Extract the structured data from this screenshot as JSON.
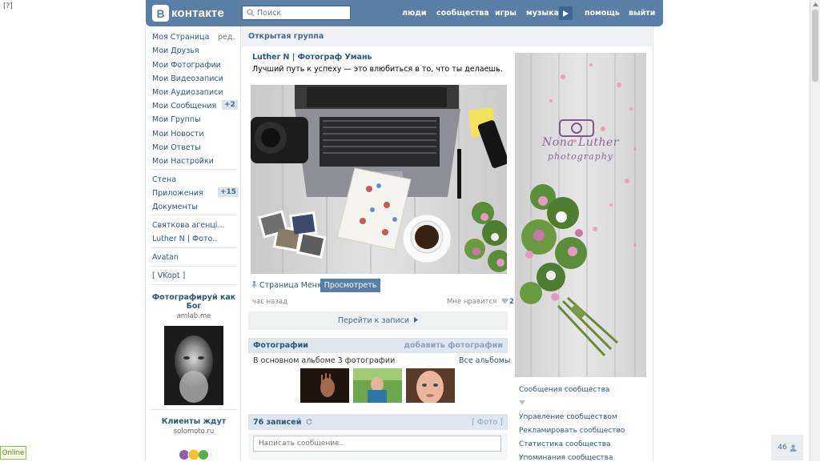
{
  "corner_mark": "[?]",
  "header": {
    "logo_text": "контакте",
    "logo_letter": "В",
    "search_placeholder": "Поиск",
    "nav": [
      "люди",
      "сообщества",
      "игры",
      "музыка",
      "помощь",
      "выйти"
    ]
  },
  "left_menu": {
    "items": [
      "Моя Страница",
      "Мои Друзья",
      "Мои Фотографии",
      "Мои Видеозаписи",
      "Мои Аудиозаписи",
      "Мои Сообщения",
      "Мои Группы",
      "Мои Новости",
      "Мои Ответы",
      "Мои Настройки"
    ],
    "edit_label": "ред.",
    "messages_badge": "+2",
    "group2": [
      "Стена",
      "Приложения",
      "Документы"
    ],
    "apps_badge": "+15",
    "group3": [
      "Святкова агенці...",
      "Luther N | Фото.."
    ],
    "group4": [
      "Avatan"
    ],
    "group5": [
      "[ VKopt ]"
    ]
  },
  "ads": [
    {
      "title": "Фотографируй как Бог",
      "site": "amlab.me"
    },
    {
      "title": "Клиенты ждут",
      "site": "solomoto.ru"
    }
  ],
  "main": {
    "group_type": "Открытая группа",
    "post": {
      "author": "Luther N | Фотограф Умань",
      "text": "Лучший путь к успеху — это влюбиться в то, что ты делаешь.",
      "link_label": "Страница Меню",
      "view_button": "Просмотреть",
      "time": "час назад",
      "like_label": "Мне нравится",
      "like_count": "2"
    },
    "goto_posts": "Перейти к записи",
    "photos": {
      "title": "Фотографии",
      "add_label": "добавить фотографии",
      "album_info": "В основном альбоме 3 фотографии",
      "all_albums": "Все альбомы"
    },
    "wall": {
      "count_label": "76 записей",
      "photo_filter": "[ Фото ]",
      "message_placeholder": "Написать сообщение.."
    }
  },
  "right": {
    "cover_name": "Nona Luther",
    "cover_sub": "photography",
    "links": [
      "Сообщения сообщества",
      "Управление сообществом",
      "Рекламировать сообщество",
      "Статистика сообщества",
      "Упоминания сообщества"
    ]
  },
  "status": {
    "online": "Online",
    "counter": "46"
  }
}
